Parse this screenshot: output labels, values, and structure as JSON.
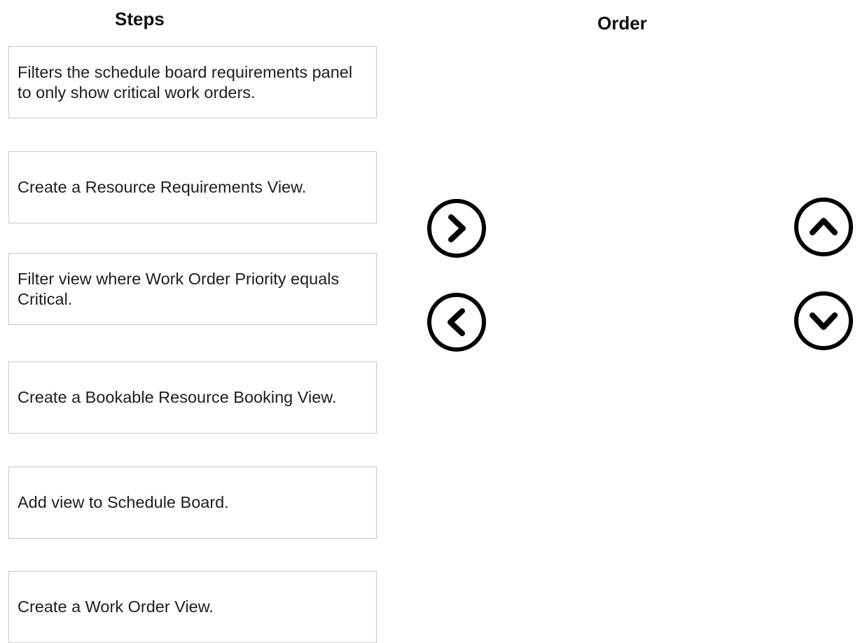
{
  "headings": {
    "steps": "Steps",
    "order": "Order"
  },
  "steps": [
    {
      "text": "Filters the schedule board requirements panel to only show critical work orders."
    },
    {
      "text": "Create a Resource Requirements View."
    },
    {
      "text": "Filter view where Work Order Priority equals Critical."
    },
    {
      "text": "Create a Bookable Resource Booking View."
    },
    {
      "text": "Add view to Schedule Board."
    },
    {
      "text": "Create a Work Order View."
    }
  ],
  "order": [],
  "controls": {
    "move_right_icon": "chevron-right-circle-icon",
    "move_left_icon": "chevron-left-circle-icon",
    "move_up_icon": "chevron-up-circle-icon",
    "move_down_icon": "chevron-down-circle-icon"
  },
  "colors": {
    "box_border": "#c8c8c8",
    "icon_stroke": "#000000"
  }
}
